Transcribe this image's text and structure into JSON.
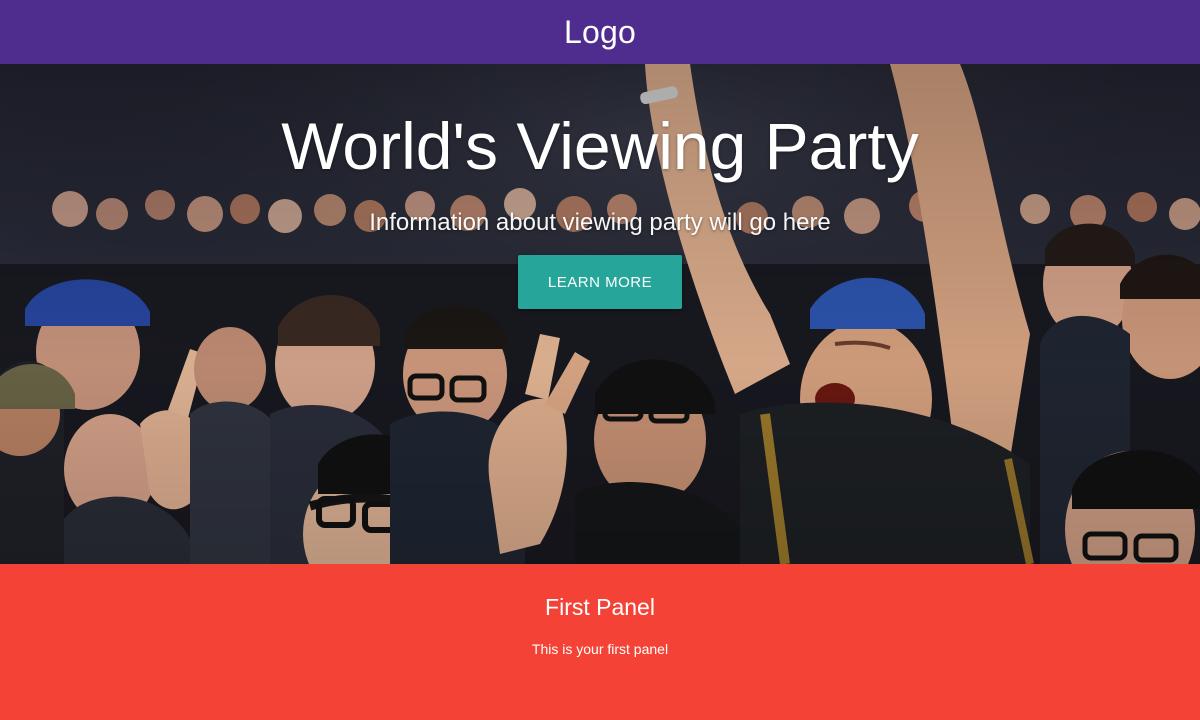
{
  "header": {
    "logo": "Logo",
    "background_color": "#4f2d8f"
  },
  "hero": {
    "title": "World's Viewing Party",
    "subtitle": "Information about viewing party will go here",
    "cta_label": "LEARN MORE",
    "cta_color": "#26a69a",
    "image_description_icon": "crowd-photo"
  },
  "panel": {
    "title": "First Panel",
    "text": "This is your first panel",
    "background_color": "#f44336"
  }
}
